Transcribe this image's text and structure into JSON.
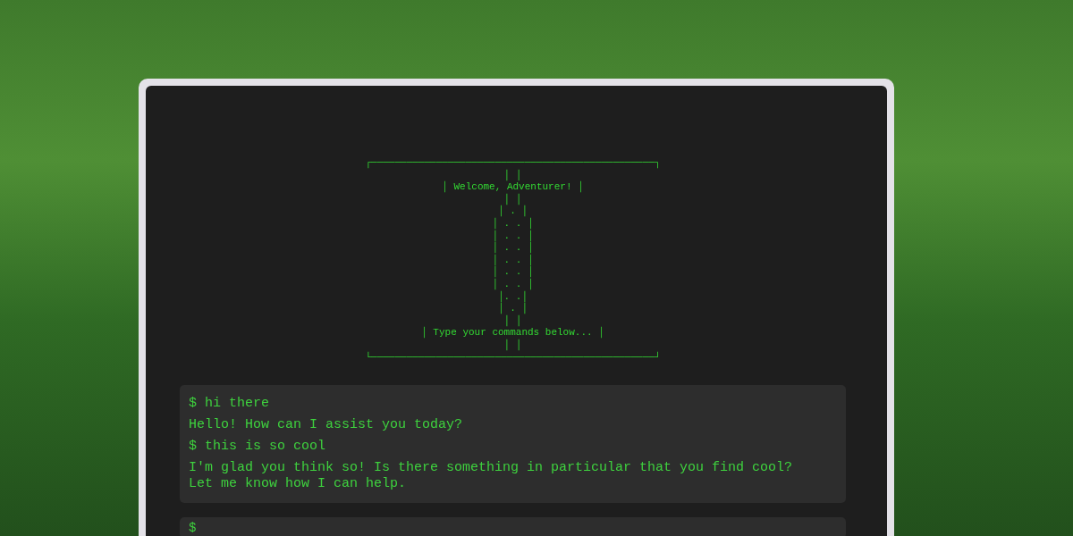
{
  "banner": {
    "lines": [
      "┌────────────────────────────────────────────────┐",
      "│ │",
      "│ Welcome, Adventurer! │",
      "│ │",
      "│ . │",
      "│ . . │",
      "│ . . │",
      "│ . . │",
      "│ . . │",
      "│ . . │",
      "│ . . │",
      "│. .│",
      "│ . │",
      "│ │",
      "│ Type your commands below... │",
      "│ │",
      "└────────────────────────────────────────────────┘"
    ]
  },
  "messages": [
    {
      "text": "$ hi there"
    },
    {
      "text": "Hello! How can I assist you today?"
    },
    {
      "text": "$ this is so cool"
    },
    {
      "text": "I'm glad you think so! Is there something in particular that you find cool? Let me know how I can help."
    }
  ],
  "input": {
    "prompt": "$"
  }
}
